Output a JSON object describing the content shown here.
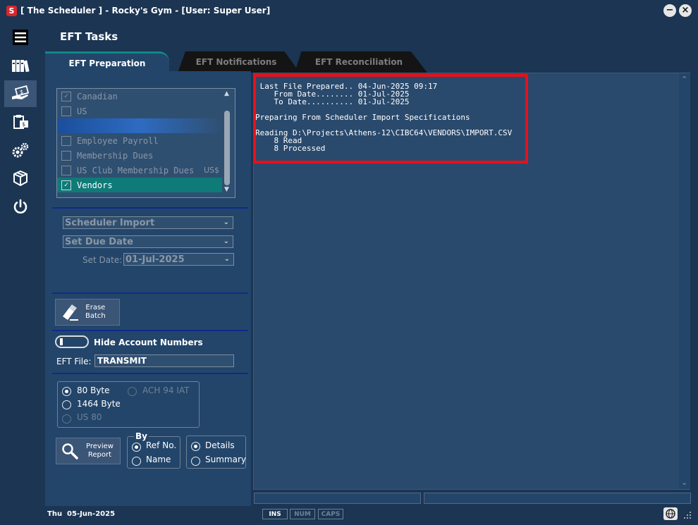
{
  "window": {
    "title": "[ The Scheduler ] - Rocky's Gym - [User: Super User]",
    "app_icon_letter": "S",
    "minimize_glyph": "−",
    "close_glyph": "×"
  },
  "sidebar": {
    "items": [
      {
        "name": "menu-icon"
      },
      {
        "name": "books-icon"
      },
      {
        "name": "money-hand-icon",
        "active": true
      },
      {
        "name": "clipboard-money-icon"
      },
      {
        "name": "gears-icon"
      },
      {
        "name": "package-icon"
      },
      {
        "name": "power-icon"
      }
    ]
  },
  "page": {
    "title": "EFT Tasks"
  },
  "tabs": [
    {
      "label": "EFT Preparation",
      "active": true
    },
    {
      "label": "EFT Notifications",
      "active": false
    },
    {
      "label": "EFT Reconciliation",
      "active": false
    }
  ],
  "list": {
    "items": [
      {
        "label": "Canadian",
        "checked": true
      },
      {
        "label": "US",
        "checked": false
      },
      {
        "label": "",
        "checked": false
      },
      {
        "label": "Employee Payroll",
        "checked": false
      },
      {
        "label": "Membership Dues",
        "checked": false
      },
      {
        "label": "US Club Membership Dues",
        "checked": false,
        "currency": "US$"
      },
      {
        "label": "Vendors",
        "checked": true
      }
    ],
    "check_glyph": "✓",
    "scroll_up": "▲",
    "scroll_down": "▼"
  },
  "selects": {
    "source": "Scheduler Import",
    "due_date_mode": "Set Due Date",
    "set_date_label": "Set Date:",
    "set_date_value": "01-Jul-2025",
    "chevron": "⌄"
  },
  "erase": {
    "label_line1": "Erase",
    "label_line2": "Batch"
  },
  "hide_account_numbers": {
    "label": "Hide Account Numbers"
  },
  "eft_file": {
    "label": "EFT File:",
    "value": "TRANSMIT"
  },
  "format": {
    "options": [
      {
        "label": "80 Byte",
        "selected": true,
        "enabled": true
      },
      {
        "label": "1464 Byte",
        "selected": false,
        "enabled": true
      },
      {
        "label": "US 80",
        "selected": false,
        "enabled": false
      },
      {
        "label": "ACH 94 IAT",
        "selected": false,
        "enabled": false
      }
    ]
  },
  "preview": {
    "label_line1": "Preview",
    "label_line2": "Report"
  },
  "by": {
    "title": "By",
    "options": [
      {
        "label": "Ref No.",
        "selected": true
      },
      {
        "label": "Name",
        "selected": false
      }
    ]
  },
  "detail": {
    "options": [
      {
        "label": "Details",
        "selected": true
      },
      {
        "label": "Summary",
        "selected": false
      }
    ]
  },
  "output": {
    "text": " Last File Prepared.. 04-Jun-2025 09:17\n    From Date........ 01-Jul-2025\n    To Date.......... 01-Jul-2025\n\nPreparing From Scheduler Import Specifications\n\nReading D:\\Projects\\Athens-12\\CIBC64\\VENDORS\\IMPORT.CSV\n    8 Read\n    8 Processed",
    "scroll_up": "⌃",
    "scroll_down": "⌄"
  },
  "status": {
    "date": "Thu  05-Jun-2025",
    "ins": "INS",
    "num": "NUM",
    "caps": "CAPS"
  },
  "colors": {
    "background": "#1b3553",
    "panel": "#23456a",
    "accent": "#0f7b78",
    "highlight_border": "#e8101a"
  }
}
